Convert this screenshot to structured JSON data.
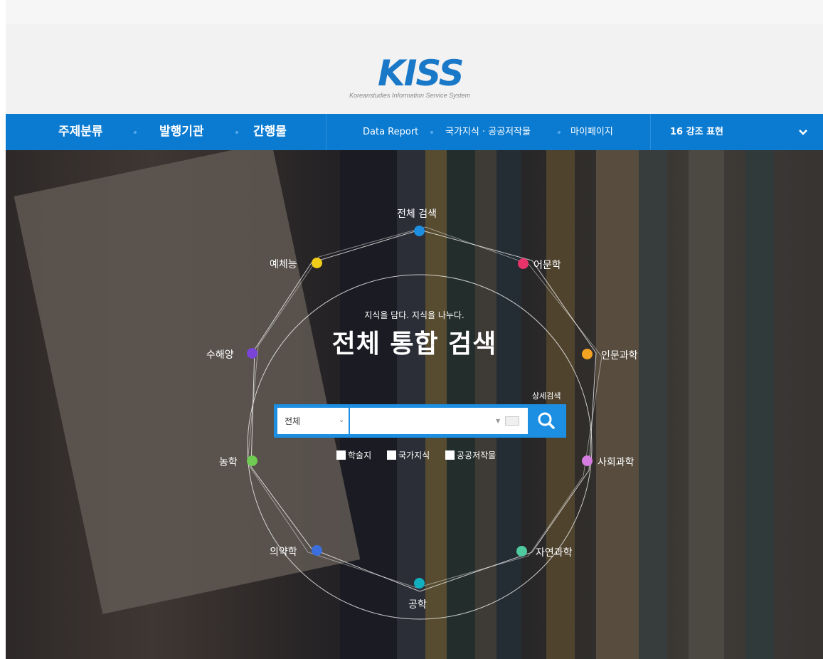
{
  "logo": {
    "mark": "KISS",
    "subtitle": "Koreanstudies Information Service System"
  },
  "nav": {
    "main": [
      "주제분류",
      "발행기관",
      "간행물"
    ],
    "sub": [
      "Data Report",
      "국가지식 · 공공저작물",
      "마이페이지"
    ],
    "highlight": "16 강조 표현"
  },
  "hero": {
    "tagline": "지식을 담다. 지식을 나누다.",
    "title": "전체 통합 검색",
    "advanced_search": "상세검색"
  },
  "search": {
    "scope_selected": "전체",
    "query_value": "",
    "query_placeholder": ""
  },
  "filters": [
    "학술지",
    "국가지식",
    "공공저작물"
  ],
  "categories": {
    "top": "전체 검색",
    "c1": "어문학",
    "c2": "인문과학",
    "c3": "사회과학",
    "c4": "자연과학",
    "c5": "공학",
    "c6": "의약학",
    "c7": "농학",
    "c8": "수해양",
    "c9": "예체능"
  },
  "colors": {
    "nav_bg": "#0b7bd1",
    "search_bg": "#1d8fe2",
    "top": "#1c8fe0",
    "c1": "#e8336a",
    "c2": "#f3a422",
    "c3": "#d77ce0",
    "c4": "#4ec9a0",
    "c5": "#12b0bf",
    "c6": "#3b6fde",
    "c7": "#6fcb52",
    "c8": "#7a44d6",
    "c9": "#f1cc19"
  },
  "icons": {
    "search": "search-icon",
    "keyboard": "keyboard-icon",
    "chevron": "chevron-down-icon"
  }
}
